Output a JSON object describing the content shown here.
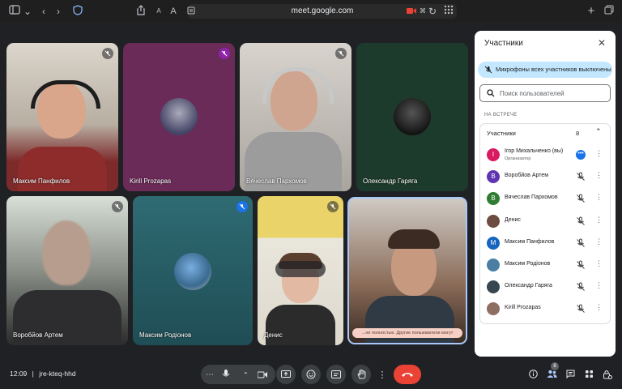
{
  "browser": {
    "url": "meet.google.com",
    "icons": [
      "sidebar-icon",
      "chevron-down-icon",
      "back-icon",
      "forward-icon",
      "shield-icon",
      "share-icon",
      "text-small-icon",
      "text-large-icon",
      "reader-icon",
      "camera-icon",
      "translate-icon",
      "reload-icon",
      "grid-icon",
      "new-tab-icon",
      "tabs-icon"
    ],
    "text_small": "A",
    "text_large": "A"
  },
  "tiles": [
    {
      "name": "Максим Панфилов",
      "muted": true
    },
    {
      "name": "Kirill Prozapas",
      "muted": true
    },
    {
      "name": "Вячеслав Пархомов",
      "muted": true
    },
    {
      "name": "Олександр Гаряга",
      "muted": false
    },
    {
      "name": "Воробйов Артем",
      "muted": true
    },
    {
      "name": "Максим Родіонов",
      "muted": true
    },
    {
      "name": "Денис",
      "muted": true
    },
    {
      "name": "",
      "muted": false
    }
  ],
  "presenting_banner": "...не полностью. Другие пользователи могут",
  "panel": {
    "title": "Участники",
    "mute_banner": "Микрофоны всех участников выключены",
    "search_placeholder": "Поиск пользователей",
    "section": "НА ВСТРЕЧЕ",
    "list_label": "Участники",
    "count": "8",
    "participants": [
      {
        "initial": "I",
        "name": "Ігор Михальченко (вы)",
        "role": "Организатор",
        "color": "#d81b60"
      },
      {
        "initial": "В",
        "name": "Воробйов Артем",
        "role": "",
        "color": "#5e35b1"
      },
      {
        "initial": "В",
        "name": "Вячеслав Пархомов",
        "role": "",
        "color": "#2e7d32"
      },
      {
        "initial": "",
        "name": "Денис",
        "role": "",
        "color": "#6d4c41"
      },
      {
        "initial": "М",
        "name": "Максим Панфилов",
        "role": "",
        "color": "#1565c0"
      },
      {
        "initial": "",
        "name": "Максим Родіонов",
        "role": "",
        "color": "#4a7fa3"
      },
      {
        "initial": "",
        "name": "Олександр Гаряга",
        "role": "",
        "color": "#37474f"
      },
      {
        "initial": "",
        "name": "Kirill Prozapas",
        "role": "",
        "color": "#8d6e63"
      }
    ]
  },
  "bottom": {
    "time": "12:09",
    "separator": "|",
    "meeting_code": "jre-kteq-hhd",
    "people_badge": "8",
    "leave_color": "#ea4335"
  }
}
